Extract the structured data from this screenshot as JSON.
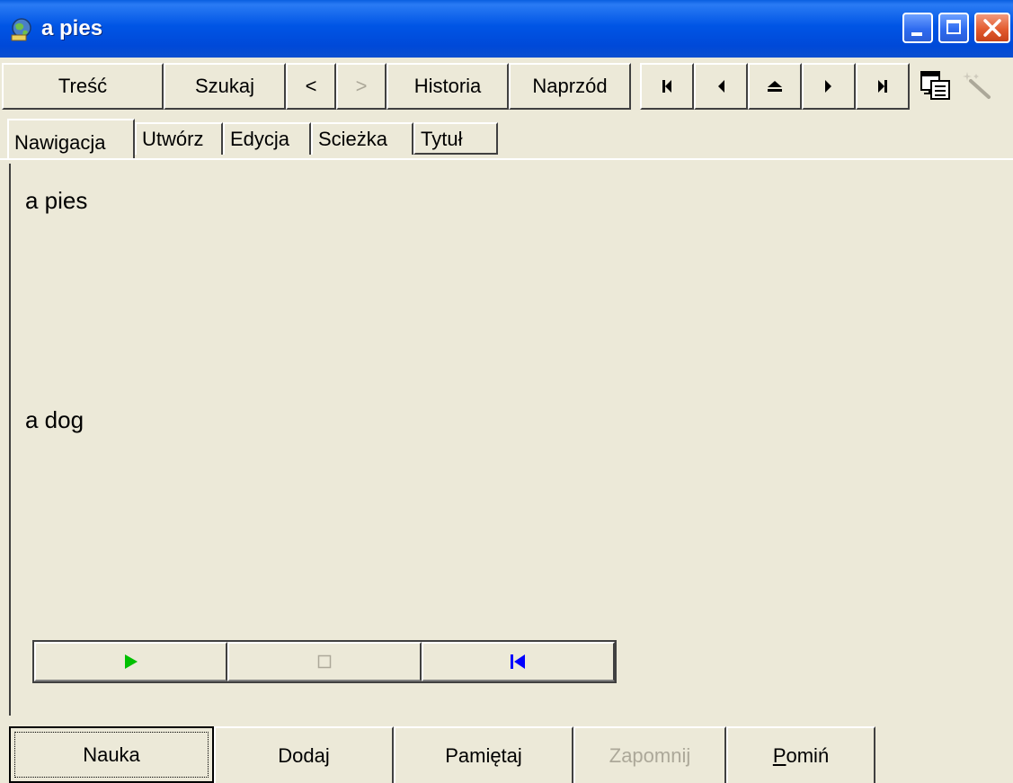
{
  "window": {
    "title": "a pies"
  },
  "toolbar": {
    "contents_label": "Treść",
    "search_label": "Szukaj",
    "back_label": "<",
    "forward_label": ">",
    "history_label": "Historia",
    "next_label": "Naprzód",
    "icons": [
      "first-icon",
      "previous-icon",
      "up-icon",
      "next-icon",
      "last-icon",
      "window-icon",
      "wand-icon"
    ]
  },
  "tabs": [
    {
      "label": "Nawigacja",
      "active": true
    },
    {
      "label": "Utwórz"
    },
    {
      "label": "Edycja"
    },
    {
      "label": "Scieżka"
    },
    {
      "label": "Tytuł"
    }
  ],
  "content": {
    "question": "a pies",
    "answer": "a dog"
  },
  "media": {
    "icons": [
      "play-icon",
      "stop-icon",
      "rewind-icon"
    ],
    "colors": {
      "play": "#00c000",
      "stop": "#aca899",
      "rewind": "#0000ff"
    }
  },
  "actions": {
    "learn_label": "Nauka",
    "add_label": "Dodaj",
    "remember_label": "Pamiętaj",
    "forget_label": "Zapomnij",
    "skip_label_rest": "omiń",
    "skip_label_first": "P"
  }
}
